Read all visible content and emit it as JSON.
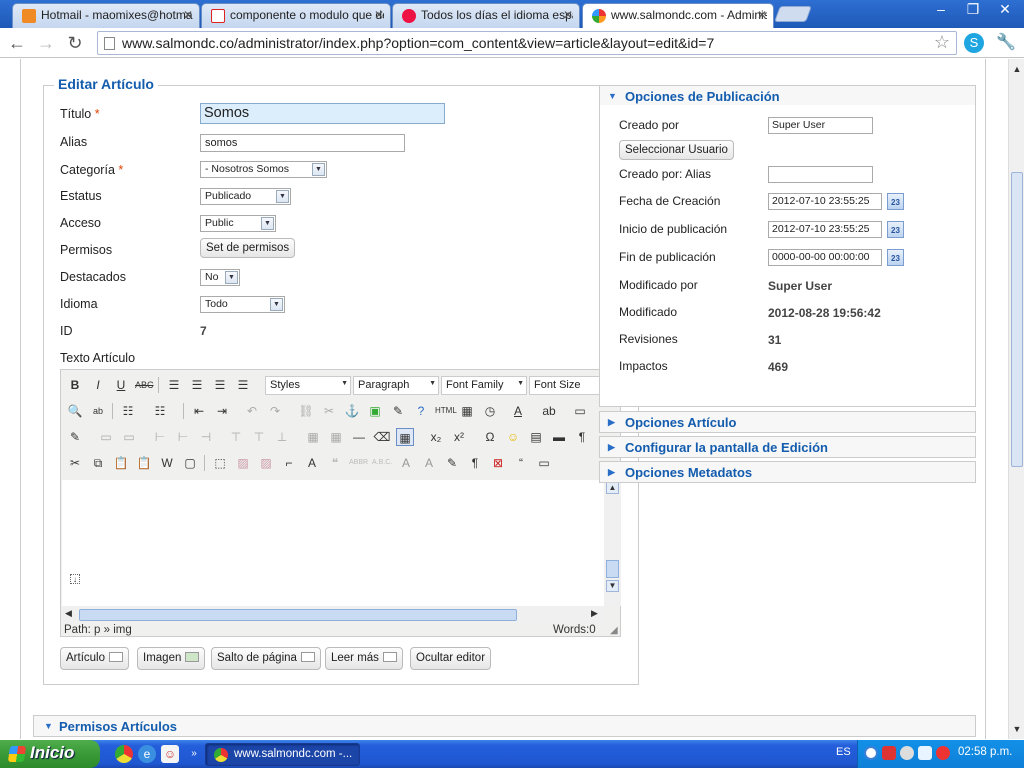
{
  "browser": {
    "tabs": [
      {
        "label": "Hotmail - maomixes@hotmail.c",
        "active": false
      },
      {
        "label": "componente o modulo que de",
        "active": false
      },
      {
        "label": "Todos los días el idioma espa",
        "active": false
      },
      {
        "label": "www.salmondc.com - Adminis",
        "active": true
      }
    ],
    "close_glyph": "✕",
    "url": "www.salmondc.co/administrator/index.php?option=com_content&view=article&layout=edit&id=7"
  },
  "edit_article": {
    "legend": "Editar Artículo",
    "required_mark": "*",
    "labels": {
      "title": "Título",
      "alias": "Alias",
      "category": "Categoría",
      "status": "Estatus",
      "access": "Acceso",
      "permissions": "Permisos",
      "featured": "Destacados",
      "language": "Idioma",
      "id": "ID",
      "text": "Texto Artículo"
    },
    "values": {
      "title": "Somos",
      "alias": "somos",
      "category": "- Nosotros Somos",
      "status": "Publicado",
      "access": "Public",
      "featured": "No",
      "language": "Todo",
      "id": "7"
    },
    "permissions_button": "Set de permisos"
  },
  "editor": {
    "styles": "Styles",
    "format": "Paragraph",
    "font_family": "Font Family",
    "font_size": "Font Size",
    "path": "Path: p » img",
    "words": "Words:0",
    "buttons": [
      "Artículo",
      "Imagen",
      "Salto de página",
      "Leer más",
      "Ocultar editor"
    ]
  },
  "publishing": {
    "header": "Opciones de Publicación",
    "created_by_label": "Creado por",
    "created_by_value": "Super User",
    "select_user_button": "Seleccionar Usuario",
    "created_alias_label": "Creado por: Alias",
    "created_alias_value": "",
    "created_date_label": "Fecha de Creación",
    "created_date_value": "2012-07-10 23:55:25",
    "publish_up_label": "Inicio de publicación",
    "publish_up_value": "2012-07-10 23:55:25",
    "publish_down_label": "Fin de publicación",
    "publish_down_value": "0000-00-00 00:00:00",
    "modified_by_label": "Modificado por",
    "modified_by_value": "Super User",
    "modified_label": "Modificado",
    "modified_value": "2012-08-28 19:56:42",
    "revisions_label": "Revisiones",
    "revisions_value": "31",
    "hits_label": "Impactos",
    "hits_value": "469",
    "calendar_glyph": "23"
  },
  "sliders": {
    "article_options": "Opciones Artículo",
    "edit_screen": "Configurar la pantalla de Edición",
    "metadata": "Opciones Metadatos",
    "permissions": "Permisos Artículos"
  },
  "taskbar": {
    "start": "Inicio",
    "task_label": "www.salmondc.com -...",
    "language": "ES",
    "clock": "02:58 p.m."
  },
  "colors": {
    "heading_blue": "#135cae",
    "title_input_bg": "#dceefb",
    "taskbar_blue": "#245edb",
    "start_green": "#3a9a37"
  }
}
